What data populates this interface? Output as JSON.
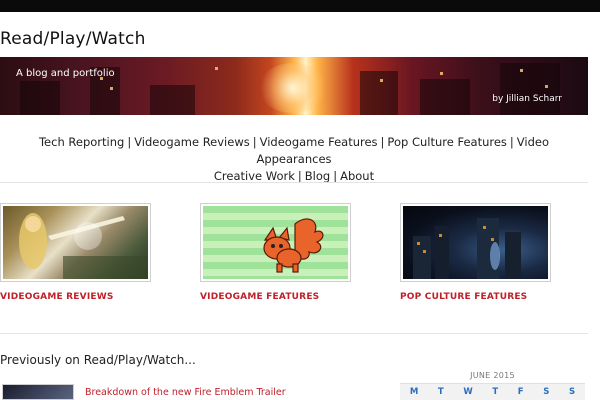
{
  "site": {
    "title": "Read/Play/Watch",
    "tagline": "A blog and portfolio",
    "byline": "by Jillian Scharr"
  },
  "nav": {
    "items": [
      "Tech Reporting",
      "Videogame Reviews",
      "Videogame Features",
      "Pop Culture Features",
      "Video Appearances",
      "Creative Work",
      "Blog",
      "About"
    ],
    "separator": "|"
  },
  "features": [
    {
      "label": "VIDEOGAME REVIEWS"
    },
    {
      "label": "VIDEOGAME FEATURES"
    },
    {
      "label": "POP CULTURE FEATURES"
    }
  ],
  "previously": {
    "heading": "Previously on Read/Play/Watch...",
    "posts": [
      {
        "title": "Breakdown of the new Fire Emblem Trailer"
      }
    ]
  },
  "calendar": {
    "month": "JUNE 2015",
    "days": [
      "M",
      "T",
      "W",
      "T",
      "F",
      "S",
      "S"
    ]
  },
  "colors": {
    "accent": "#c0202a",
    "calendar_day": "#2a6ebb",
    "topbar": "#0a0a0a"
  }
}
